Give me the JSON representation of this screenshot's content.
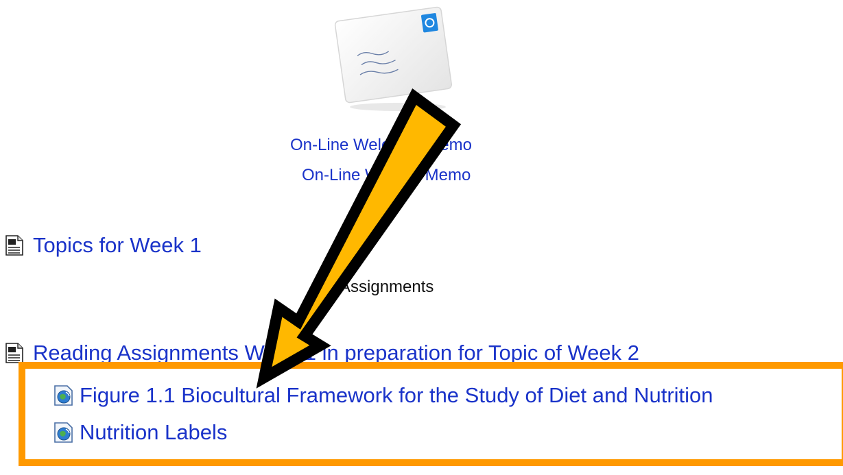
{
  "memos": [
    {
      "label": "On-Line Welcome Memo"
    },
    {
      "label": "On-Line Week 1 Memo"
    }
  ],
  "resources": {
    "topics": {
      "label": "Topics for Week 1"
    },
    "assignments_label": "Assignments",
    "reading": {
      "label": "Reading Assignments Week 1 in preparation for Topic of Week 2"
    }
  },
  "sub_resources": [
    {
      "label": "Figure 1.1 Biocultural Framework for the Study of Diet and Nutrition"
    },
    {
      "label": "Nutrition Labels"
    }
  ],
  "colors": {
    "link": "#1a33c9",
    "highlight": "#ff9900",
    "arrow_fill": "#ffb800",
    "arrow_outline": "#000000"
  },
  "icons": {
    "envelope": "envelope-icon",
    "document": "document-icon",
    "web_link": "web-link-icon",
    "email_badge": "at-sign-icon"
  }
}
